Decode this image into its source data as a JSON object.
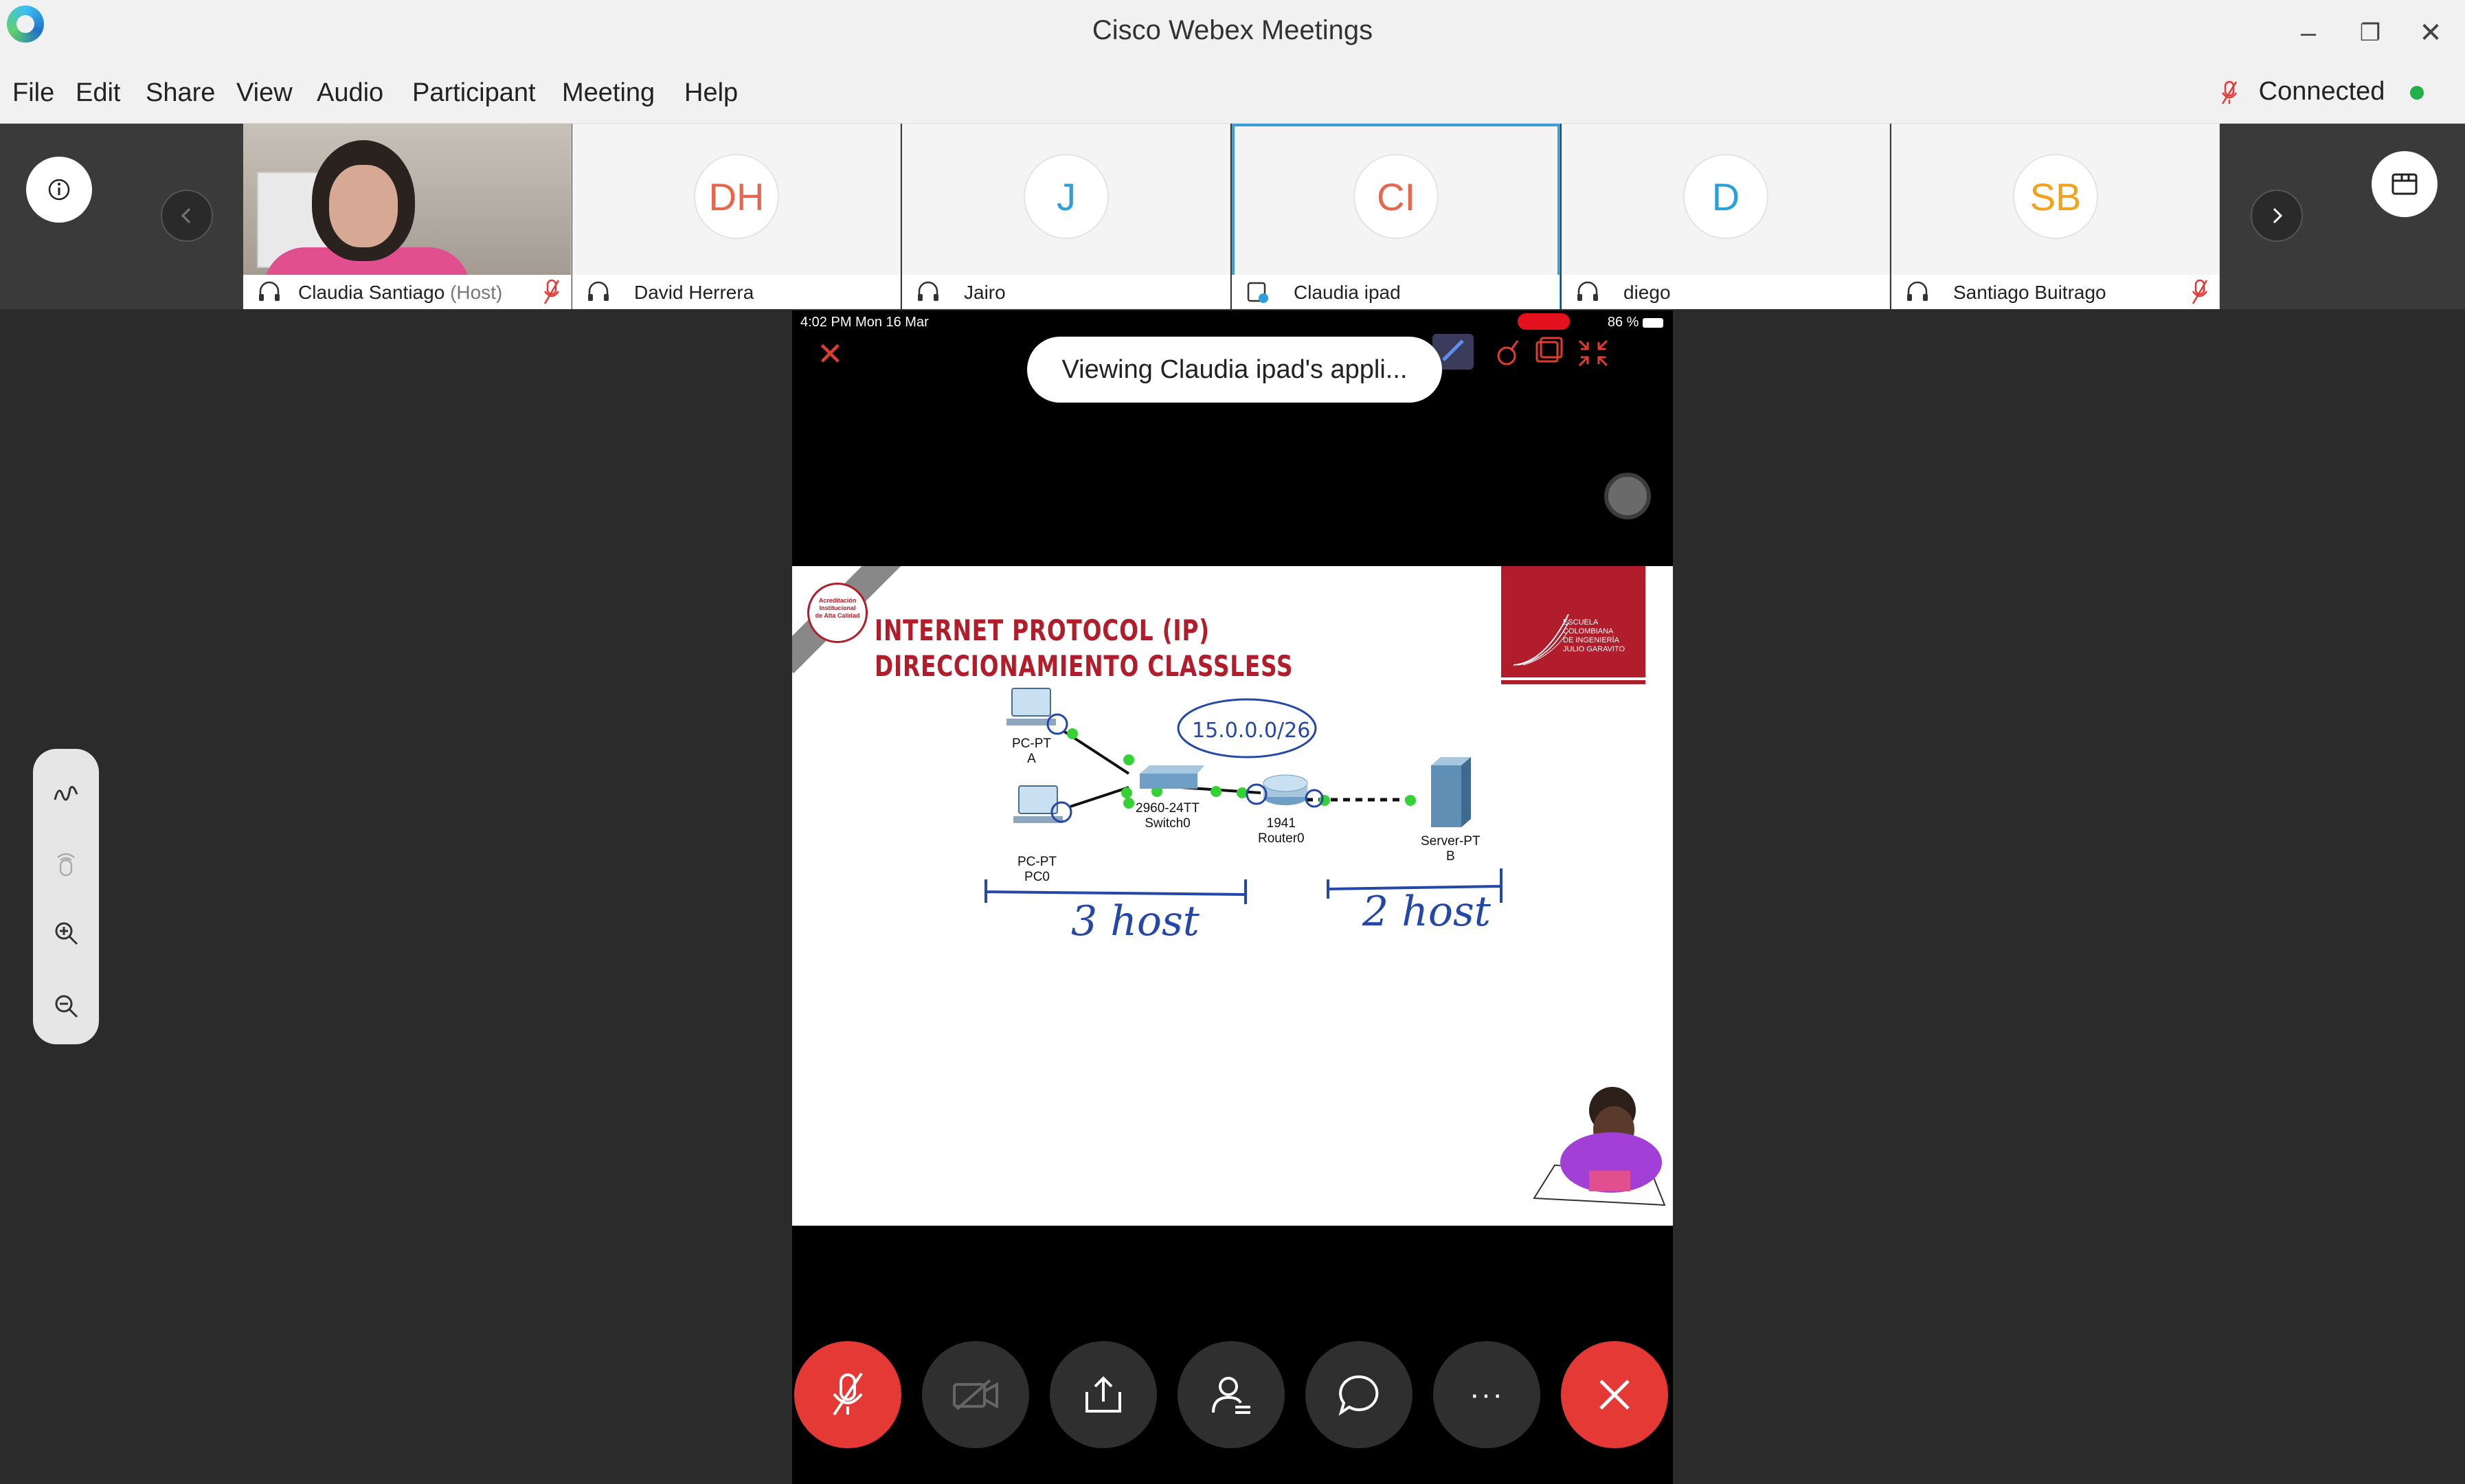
{
  "window": {
    "title": "Cisco Webex Meetings",
    "controls": {
      "minimize": "–",
      "restore": "❐",
      "close": "✕"
    }
  },
  "menu": {
    "items": [
      "File",
      "Edit",
      "Share",
      "View",
      "Audio",
      "Participant",
      "Meeting",
      "Help"
    ],
    "status": "Connected",
    "status_color": "#23b04b"
  },
  "participants": [
    {
      "initials": "",
      "name": "Claudia Santiago",
      "tag": "(Host)",
      "muted": true,
      "audio": "headset-icon"
    },
    {
      "initials": "DH",
      "name": "David Herrera",
      "color": "#e8664b",
      "muted": false,
      "audio": "headset-icon"
    },
    {
      "initials": "J",
      "name": "Jairo",
      "color": "#2a9fd8",
      "muted": false,
      "audio": "headset-icon"
    },
    {
      "initials": "CI",
      "name": "Claudia ipad",
      "color": "#e8664b",
      "muted": false,
      "active": true,
      "audio": "device-icon"
    },
    {
      "initials": "D",
      "name": "diego",
      "color": "#2a9fd8",
      "muted": false,
      "audio": "headset-icon"
    },
    {
      "initials": "SB",
      "name": "Santiago Buitrago",
      "color": "#f2a21b",
      "muted": true,
      "audio": "headset-icon"
    }
  ],
  "share": {
    "device_time": "4:02 PM   Mon 16 Mar",
    "battery": "86 %",
    "toast": "Viewing Claudia ipad's appli...",
    "slide": {
      "title_line1": "INTERNET PROTOCOL (IP)",
      "title_line2": "DIRECCIONAMIENTO CLASSLESS",
      "logo_text": [
        "ESCUELA",
        "COLOMBIANA",
        "DE INGENIERÍA",
        "JULIO GARAVITO"
      ],
      "seal_text": [
        "Acreditación",
        "Institucional",
        "de Alta Calidad"
      ],
      "network_labels": {
        "pc_a": "PC-PT\nA",
        "pc0": "PC-PT\nPC0",
        "switch": "2960-24TT\nSwitch0",
        "router": "1941\nRouter0",
        "server": "Server-PT\nB"
      },
      "annotations": {
        "subnet": "15.0.0.0/26",
        "left_hosts": "3 host",
        "right_hosts": "2 host"
      }
    }
  },
  "controls": [
    "mute-button",
    "video-button",
    "share-button",
    "participants-button",
    "chat-button",
    "more-button",
    "leave-button"
  ],
  "more_label": "···"
}
